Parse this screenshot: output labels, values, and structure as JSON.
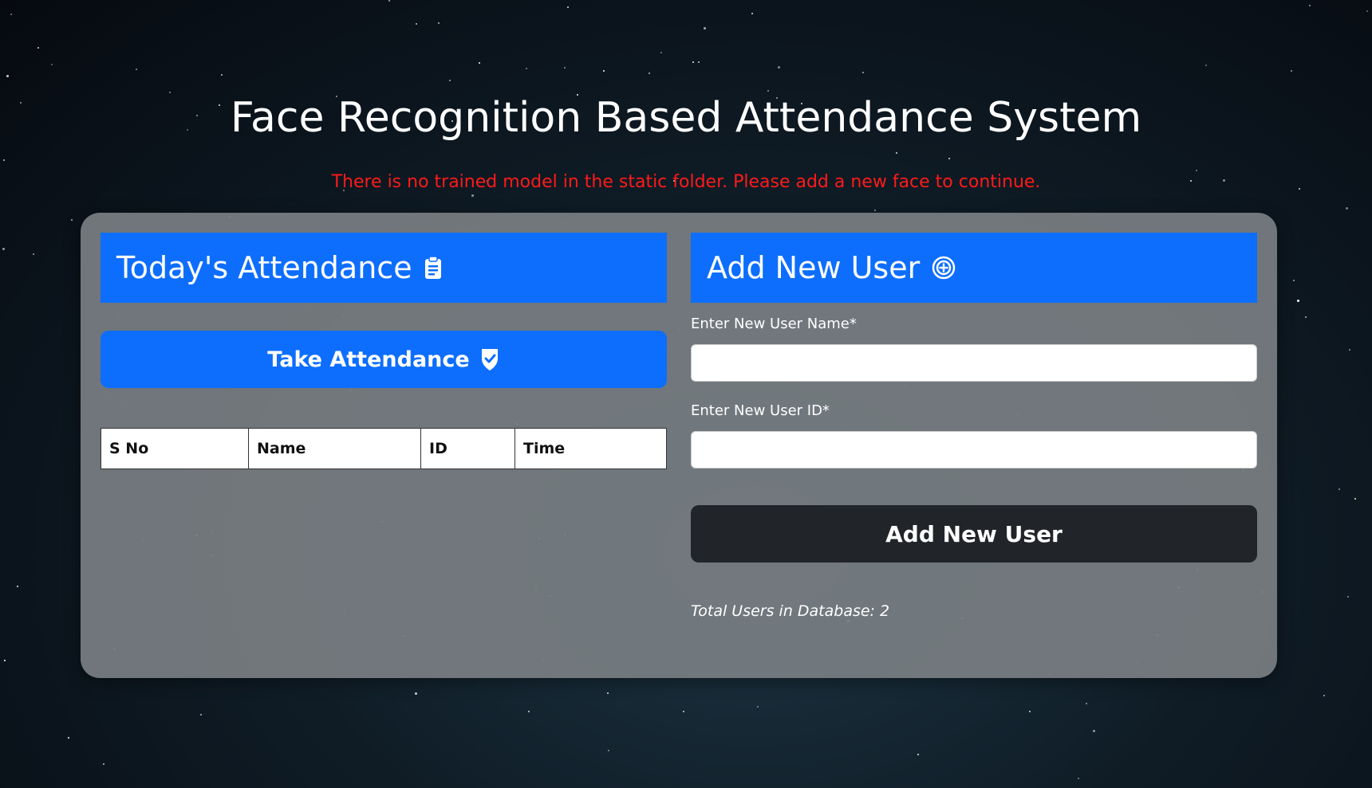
{
  "page": {
    "title": "Face Recognition Based Attendance System",
    "warning": "There is no trained model in the static folder. Please add a new face to continue."
  },
  "attendance": {
    "header": "Today's Attendance",
    "header_icon": "clipboard-icon",
    "take_button": "Take Attendance",
    "take_icon": "shield-check-icon",
    "columns": [
      "S No",
      "Name",
      "ID",
      "Time"
    ]
  },
  "add_user": {
    "header": "Add New User",
    "header_icon": "plus-circle-icon",
    "name_label": "Enter New User Name*",
    "name_value": "",
    "id_label": "Enter New User ID*",
    "id_value": "",
    "submit_label": "Add New User",
    "total_text": "Total Users in Database: 2"
  },
  "colors": {
    "primary": "#0d6efd",
    "dark": "#212529",
    "warning": "#ff1a1a"
  }
}
